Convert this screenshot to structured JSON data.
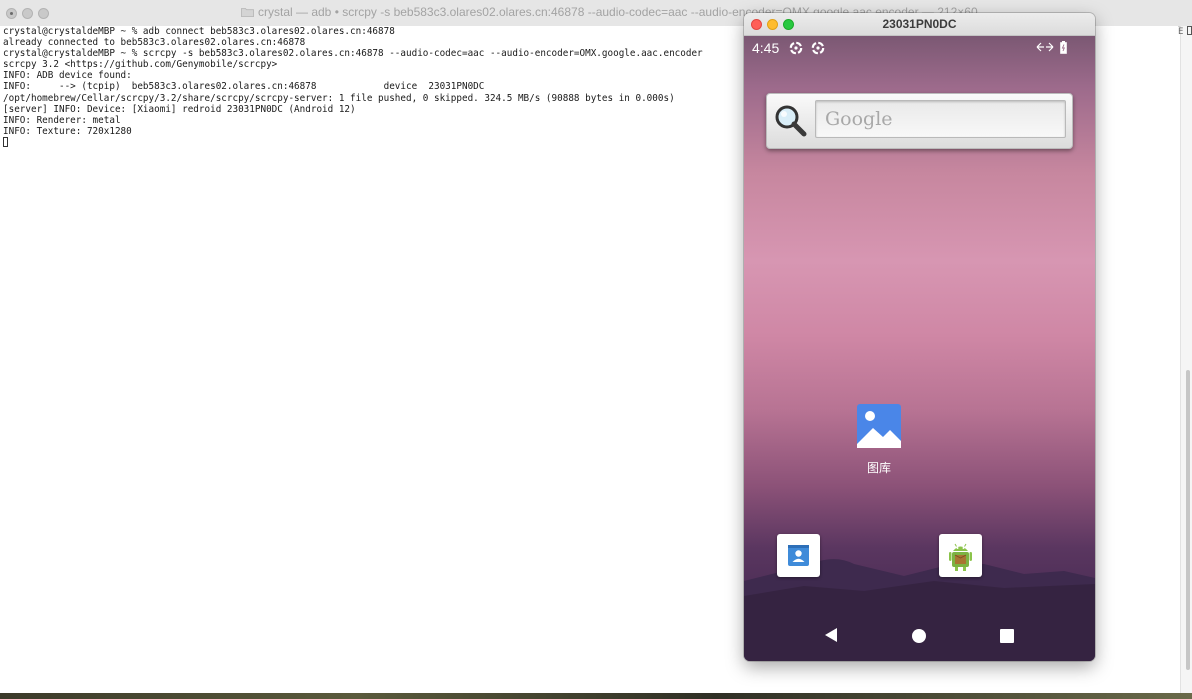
{
  "terminal": {
    "title": "crystal — adb • scrcpy -s beb583c3.olares02.olares.cn:46878 --audio-codec=aac --audio-encoder=OMX.google.aac.encoder — 212×60",
    "lines": [
      "crystal@crystaldeMBP ~ % adb connect beb583c3.olares02.olares.cn:46878",
      "already connected to beb583c3.olares02.olares.cn:46878",
      "crystal@crystaldeMBP ~ % scrcpy -s beb583c3.olares02.olares.cn:46878 --audio-codec=aac --audio-encoder=OMX.google.aac.encoder",
      "scrcpy 3.2 <https://github.com/Genymobile/scrcpy>",
      "INFO: ADB device found:",
      "INFO:     --> (tcpip)  beb583c3.olares02.olares.cn:46878            device  23031PN0DC",
      "/opt/homebrew/Cellar/scrcpy/3.2/share/scrcpy/scrcpy-server: 1 file pushed, 0 skipped. 324.5 MB/s (90888 bytes in 0.000s)",
      "[server] INFO: Device: [Xiaomi] redroid 23031PN0DC (Android 12)",
      "INFO: Renderer: metal",
      "INFO: Texture: 720x1280"
    ],
    "scrollbar_mark": "E"
  },
  "scrcpy": {
    "title": "23031PN0DC",
    "status_bar": {
      "time": "4:45",
      "icons": [
        "sync-icon",
        "sync-icon",
        "data-arrows-icon",
        "battery-icon"
      ]
    },
    "search_widget": {
      "placeholder": "Google",
      "icon": "magnifier-icon"
    },
    "home_apps": [
      {
        "label": "图库",
        "icon": "gallery-icon"
      }
    ],
    "dock_apps": [
      {
        "name": "contacts",
        "icon": "contacts-icon"
      },
      {
        "name": "apk-installer",
        "icon": "android-installer-icon"
      }
    ],
    "nav_bar": [
      "back-icon",
      "home-icon",
      "recents-icon"
    ]
  }
}
